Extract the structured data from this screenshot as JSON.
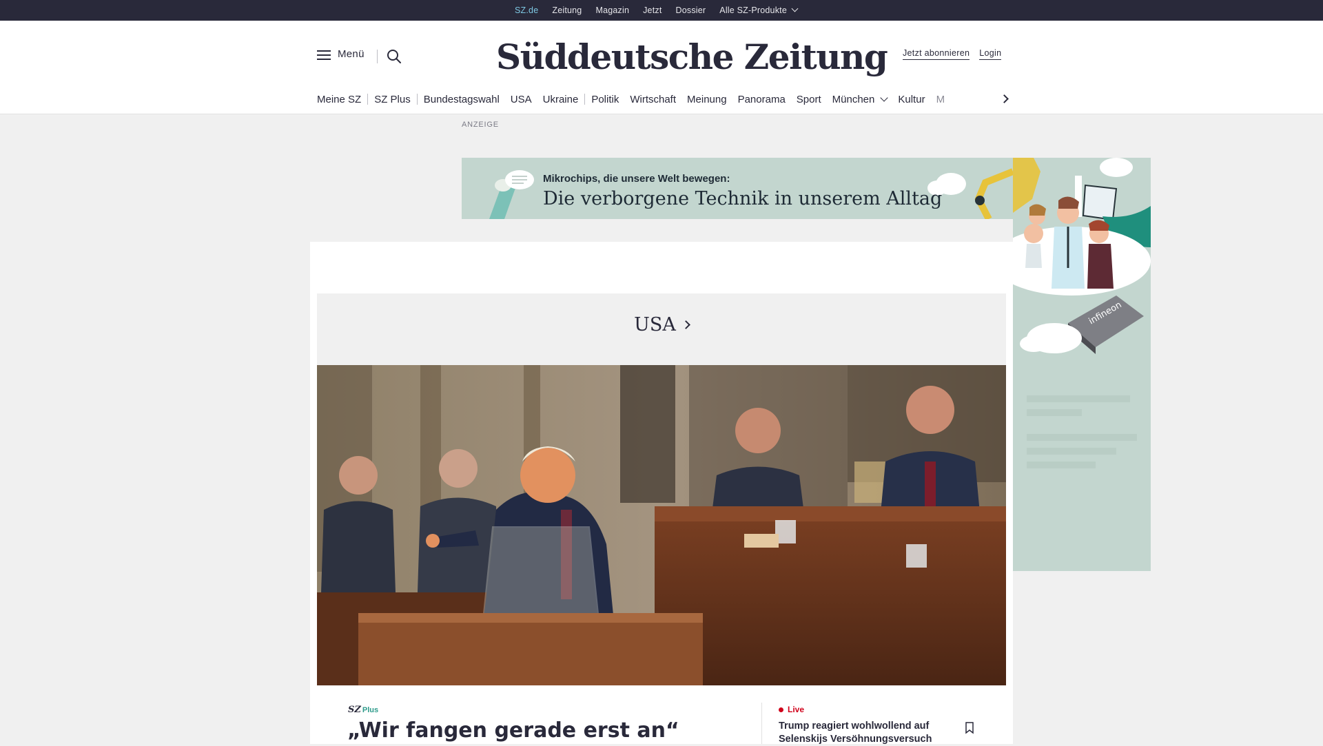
{
  "topbar": {
    "links": [
      "SZ.de",
      "Zeitung",
      "Magazin",
      "Jetzt",
      "Dossier",
      "Alle SZ-Produkte"
    ]
  },
  "header": {
    "menu_label": "Menü",
    "logo_text": "Süddeutsche Zeitung",
    "subscribe": "Jetzt abonnieren",
    "login": "Login"
  },
  "nav": {
    "items": [
      "Meine SZ",
      "SZ Plus",
      "Bundestagswahl",
      "USA",
      "Ukraine",
      "Politik",
      "Wirtschaft",
      "Meinung",
      "Panorama",
      "Sport",
      "München",
      "Kultur",
      "M"
    ]
  },
  "ad": {
    "label": "ANZEIGE",
    "kicker": "Mikrochips, die unsere Welt bewegen:",
    "headline": "Die verborgene Technik in unserem Alltag",
    "brand": "infineon"
  },
  "section": {
    "title": "USA"
  },
  "teaser": {
    "badge_sz": "SZ",
    "badge_plus": "Plus",
    "title": "„Wir fangen gerade erst an“",
    "live_label": "Live",
    "live_headline": "Trump reagiert wohlwollend auf Selenskijs Versöhnungsversuch"
  },
  "colors": {
    "topbar_bg": "#29293a",
    "active_link": "#7ec8e3",
    "ad_bg": "#c3d6cf",
    "live_red": "#d0021b",
    "plus_teal": "#2e9b8b"
  }
}
